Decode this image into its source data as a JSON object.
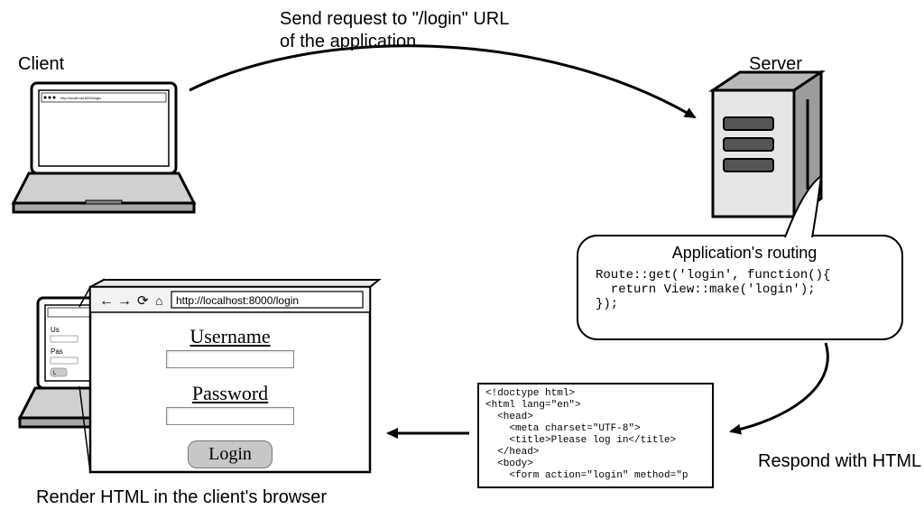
{
  "labels": {
    "client": "Client",
    "server": "Server",
    "sendRequest1": "Send request to \"/login\" URL",
    "sendRequest2": "of the application",
    "routingTitle": "Application's routing",
    "respond": "Respond with HTML",
    "render": "Render HTML in the client's browser"
  },
  "routingCode": "Route::get('login', function(){\n  return View::make('login');\n});",
  "htmlCode": "<!doctype html>\n<html lang=\"en\">\n  <head>\n    <meta charset=\"UTF-8\">\n    <title>Please log in</title>\n  </head>\n  <body>\n    <form action=\"login\" method=\"p",
  "loginForm": {
    "url": "http://localhost:8000/login",
    "username": "Username",
    "password": "Password",
    "button": "Login"
  },
  "laptop1Url": "http://localhost:8000/login"
}
